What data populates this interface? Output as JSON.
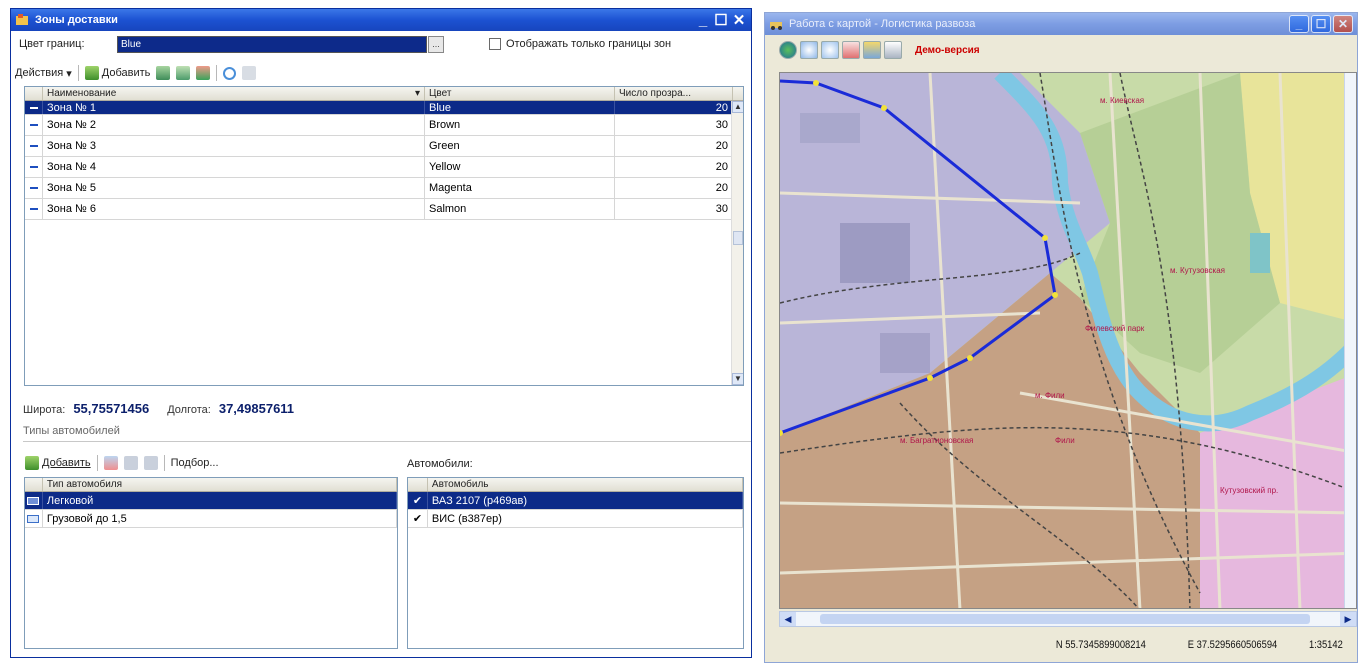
{
  "zones_window": {
    "title": "Зоны доставки",
    "border_color_label": "Цвет границ:",
    "border_color_value": "Blue",
    "ellipsis": "...",
    "only_borders_label": "Отображать только границы зон",
    "toolbar": {
      "actions": "Действия",
      "add": "Добавить"
    },
    "zones_grid": {
      "headers": [
        "Наименование",
        "Цвет",
        "Число прозра..."
      ],
      "rows": [
        {
          "name": "Зона № 1",
          "color": "Blue",
          "value": "20",
          "selected": true
        },
        {
          "name": "Зона № 2",
          "color": "Brown",
          "value": "30",
          "selected": false
        },
        {
          "name": "Зона № 3",
          "color": "Green",
          "value": "20",
          "selected": false
        },
        {
          "name": "Зона № 4",
          "color": "Yellow",
          "value": "20",
          "selected": false
        },
        {
          "name": "Зона № 5",
          "color": "Magenta",
          "value": "20",
          "selected": false
        },
        {
          "name": "Зона № 6",
          "color": "Salmon",
          "value": "30",
          "selected": false
        }
      ]
    },
    "latitude_label": "Широта:",
    "latitude_value": "55,75571456",
    "longitude_label": "Долгота:",
    "longitude_value": "37,49857611",
    "vehicle_types_section": "Типы автомобилей",
    "vehicle_toolbar": {
      "add": "Добавить",
      "pick": "Подбор..."
    },
    "vehicles_label": "Автомобили:",
    "types_grid": {
      "header": "Тип автомобиля",
      "rows": [
        {
          "name": "Легковой",
          "selected": true
        },
        {
          "name": "Грузовой до 1,5",
          "selected": false
        }
      ]
    },
    "cars_grid": {
      "header": "Автомобиль",
      "rows": [
        {
          "name": "ВАЗ 2107 (р469ав)",
          "selected": true
        },
        {
          "name": "ВИС (в387ер)",
          "selected": false
        }
      ]
    }
  },
  "map_window": {
    "title": "Работа с картой - Логистика развоза",
    "demo_label": "Демо-версия",
    "labels": [
      "м. Киевская",
      "м. Кутузовская",
      "м. Фили",
      "м. Багратионовская",
      "Кутузовский пр.",
      "Фили",
      "Филевский парк"
    ],
    "status": {
      "north": "N  55.7345899008214",
      "east": "E  37.5295660506594",
      "scale": "1:35142"
    }
  },
  "colors": {
    "selection": "#0c2a88",
    "zone_border": "#1a2bd8",
    "title_active": "#1c52d2"
  }
}
